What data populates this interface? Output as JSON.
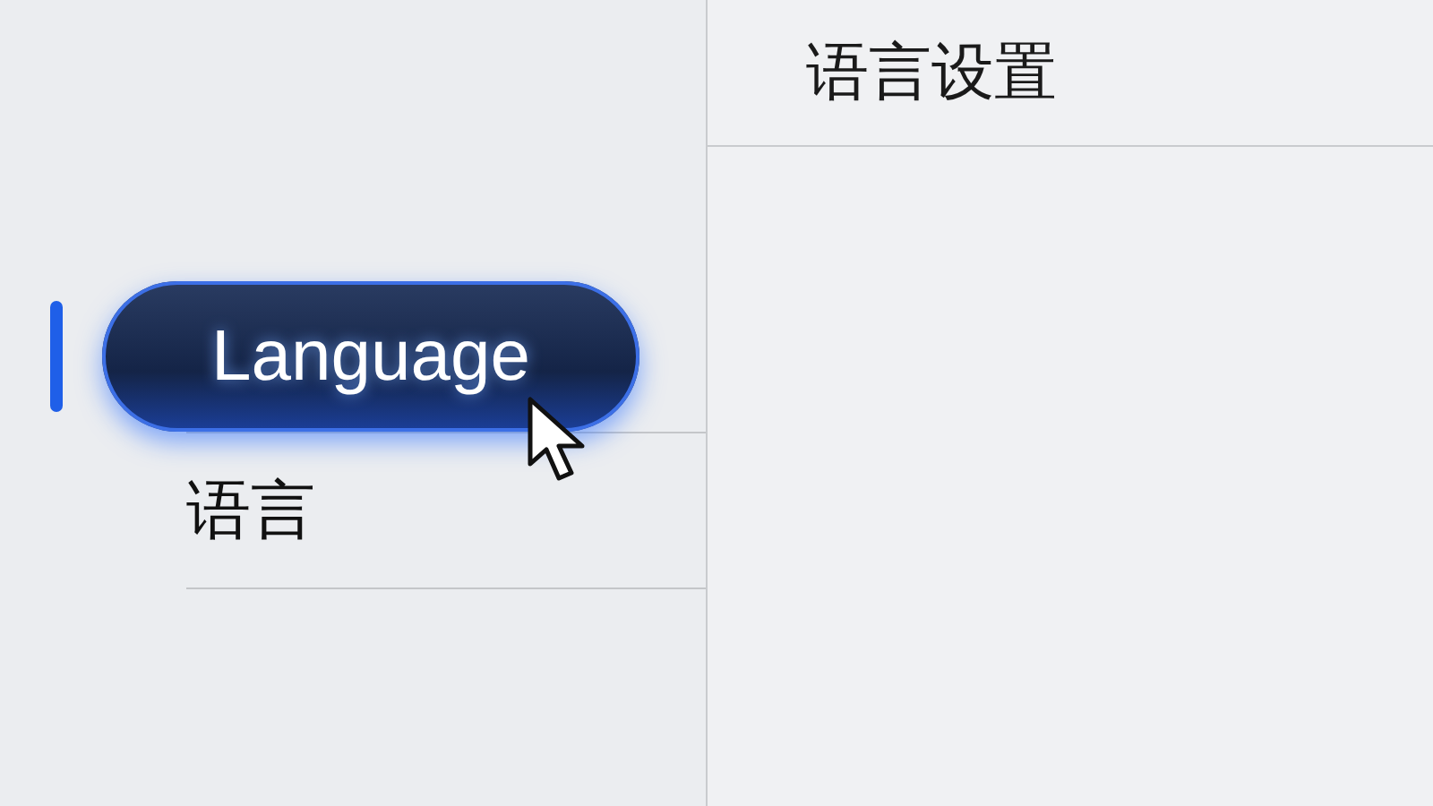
{
  "sidebar": {
    "items": [
      {
        "label": "Language",
        "selected": true
      },
      {
        "label": "语言",
        "selected": false
      }
    ]
  },
  "panel": {
    "title": "语言设置"
  }
}
